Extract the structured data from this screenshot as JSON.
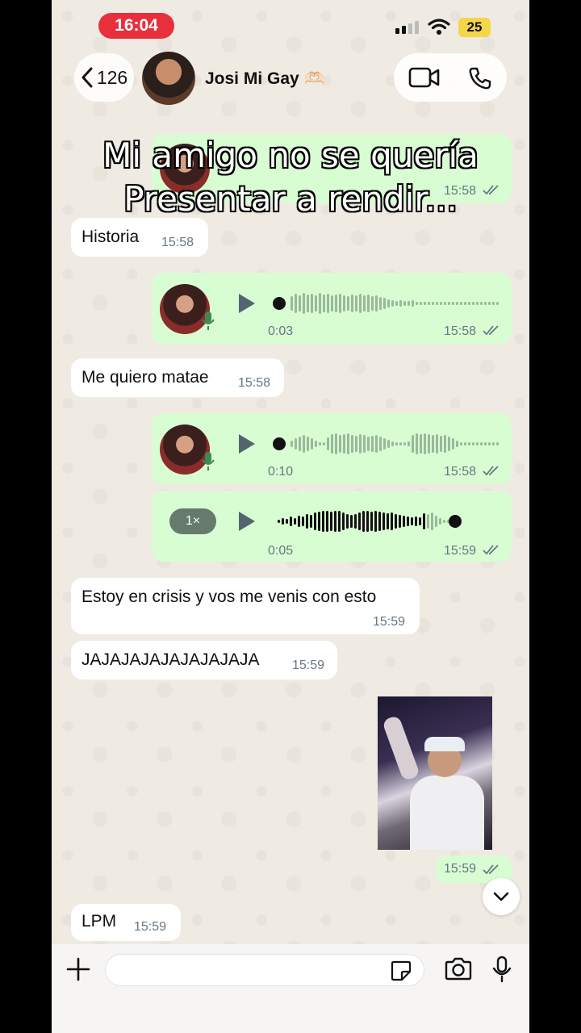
{
  "status_bar": {
    "time": "16:04",
    "battery": "25"
  },
  "header": {
    "back_count": "126",
    "contact_name": "Josi Mi Gay 🫶🏻"
  },
  "caption": {
    "line1": "Mi amigo no se quería",
    "line2": "Presentar a rendir..."
  },
  "messages": [
    {
      "type": "voice-out",
      "time": "15:58"
    },
    {
      "type": "text-in",
      "text": "Historia",
      "time": "15:58"
    },
    {
      "type": "voice-out",
      "duration": "0:03",
      "time": "15:58"
    },
    {
      "type": "text-in",
      "text": "Me quiero matae",
      "time": "15:58"
    },
    {
      "type": "voice-out",
      "duration": "0:10",
      "time": "15:58"
    },
    {
      "type": "voice-out",
      "speed": "1×",
      "duration": "0:05",
      "time": "15:59"
    },
    {
      "type": "text-in",
      "text": "Estoy en crisis y vos me venis con esto",
      "time": "15:59"
    },
    {
      "type": "text-in",
      "text": "JAJAJAJAJAJAJAJAJA",
      "time": "15:59"
    },
    {
      "type": "image-out",
      "time": "15:59"
    },
    {
      "type": "text-in",
      "text": "LPM",
      "time": "15:59"
    }
  ],
  "composer": {
    "placeholder": ""
  },
  "icons": [
    "chevron-left-icon",
    "video-call-icon",
    "phone-icon",
    "plus-icon",
    "sticker-icon",
    "camera-icon",
    "mic-icon",
    "chevron-down-icon"
  ],
  "colors": {
    "outgoing": "#d9fdd3",
    "incoming": "#ffffff",
    "time_pill": "#e8303c",
    "battery": "#f4d64a"
  }
}
